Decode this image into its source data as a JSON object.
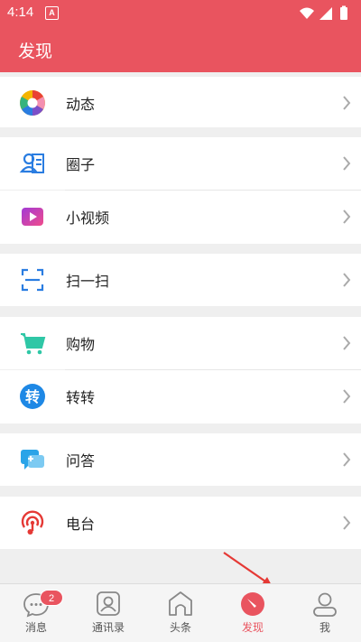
{
  "status": {
    "time": "4:14",
    "notif_letter": "A"
  },
  "header": {
    "title": "发现"
  },
  "menu": [
    {
      "label": "动态"
    },
    {
      "label": "圈子"
    },
    {
      "label": "小视频"
    },
    {
      "label": "扫一扫"
    },
    {
      "label": "购物"
    },
    {
      "label": "转转"
    },
    {
      "label": "问答"
    },
    {
      "label": "电台"
    }
  ],
  "tabs": [
    {
      "label": "消息",
      "badge": "2"
    },
    {
      "label": "通讯录"
    },
    {
      "label": "头条"
    },
    {
      "label": "发现"
    },
    {
      "label": "我"
    }
  ],
  "colors": {
    "accent": "#e9545f",
    "background": "#efefef"
  },
  "icons": [
    "aperture-icon",
    "contacts-card-icon",
    "video-icon",
    "scan-icon",
    "cart-icon",
    "zhuan-icon",
    "qa-chat-icon",
    "radio-icon",
    "chevron-right-icon"
  ]
}
